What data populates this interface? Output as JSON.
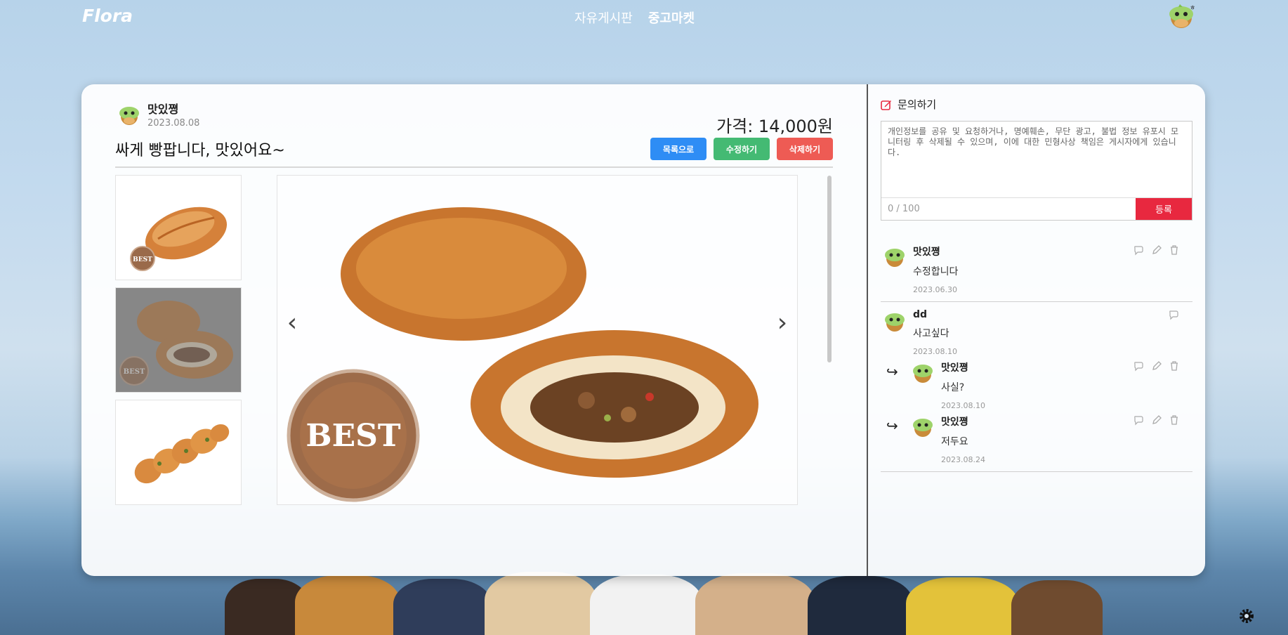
{
  "brand": "Flora",
  "nav": {
    "free_board": "자유게시판",
    "market": "중고마켓"
  },
  "post": {
    "author": "맛있쪙",
    "date": "2023.08.08",
    "price": "가격: 14,000원",
    "title": "싸게 빵팝니다, 맛있어요~",
    "buttons": {
      "list": "목록으로",
      "edit": "수정하기",
      "delete": "삭제하기"
    }
  },
  "inquiry": {
    "title": "문의하기",
    "placeholder": "개인정보를 공유 및 요청하거나, 명예훼손, 무단 광고, 불법 정보 유포시 모니터링 후 삭제될 수 있으며, 이에 대한 민형사상 책임은 게시자에게 있습니다.",
    "count": "0 / 100",
    "submit": "등록"
  },
  "comments": [
    {
      "author": "맛있쪙",
      "text": "수정합니다",
      "date": "2023.06.30"
    },
    {
      "author": "dd",
      "text": "사고싶다",
      "date": "2023.08.10",
      "replies": [
        {
          "author": "맛있쪙",
          "text": "사실?",
          "date": "2023.08.10"
        },
        {
          "author": "맛있쪙",
          "text": "저두요",
          "date": "2023.08.24"
        }
      ]
    }
  ],
  "icons": [
    "pencil-square-icon",
    "chat-icon",
    "pencil-icon",
    "trash-icon",
    "chevron-left-icon",
    "chevron-right-icon",
    "gear-icon",
    "reply-arrow-icon"
  ],
  "colors": {
    "blue": "#2e8df5",
    "green": "#44ba73",
    "red": "#ee5b54",
    "submit": "#e8283f",
    "edit_icon": "#e8283f"
  }
}
